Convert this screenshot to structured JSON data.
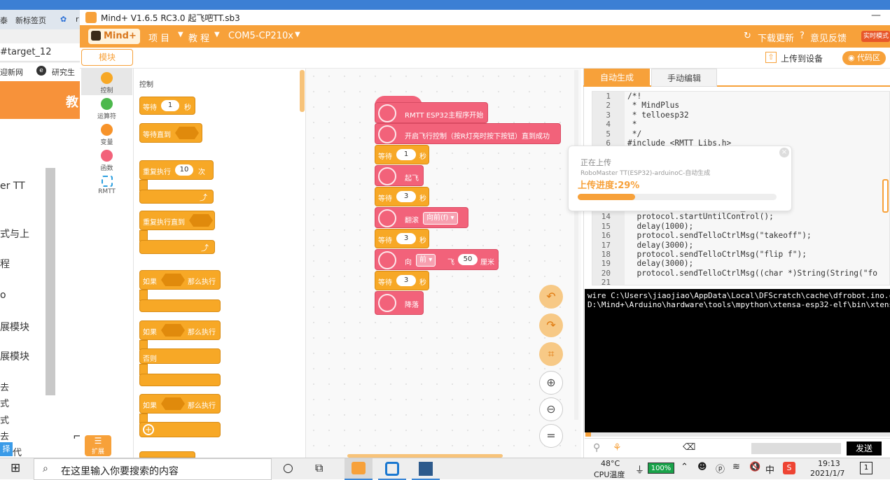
{
  "background": {
    "browser_tabs": [
      "泰",
      "新标签页",
      "r"
    ],
    "address": "#target_12",
    "bookmarks": [
      "迎新网",
      "研究生"
    ],
    "banner_char": "教",
    "side_items": [
      "er TT",
      "式与上",
      "程",
      "o",
      "展模块",
      "展模块",
      "去",
      "式",
      "式",
      "去",
      "代"
    ],
    "side_badge": "择"
  },
  "app": {
    "title": "Mind+ V1.6.5 RC3.0  起飞吧TT.sb3",
    "logo": "Mind+"
  },
  "menu": {
    "project": "项 目",
    "tutorial": "教 程",
    "port": "COM5-CP210x",
    "download_update": "下载更新",
    "feedback": "意见反馈",
    "realtime": "实时模式"
  },
  "toolbar": {
    "module_tab": "模块",
    "upload": "上传到设备",
    "code_area": "代码区"
  },
  "categories": [
    {
      "label": "控制",
      "color": "#f7a826"
    },
    {
      "label": "运算符",
      "color": "#4cb84c"
    },
    {
      "label": "变量",
      "color": "#f7932a"
    },
    {
      "label": "函数",
      "color": "#f2627a"
    },
    {
      "label": "RMTT",
      "color": "#2c9fe0"
    }
  ],
  "extension_label": "扩展",
  "palette": {
    "title": "控制",
    "wait": "等待",
    "wait_val": "1",
    "sec": "秒",
    "wait_until": "等待直到",
    "repeat": "重复执行",
    "repeat_val": "10",
    "times": "次",
    "repeat_until": "重复执行直到",
    "if1": "如果",
    "then1": "那么执行",
    "if2": "如果",
    "then2": "那么执行",
    "else": "否则",
    "if3": "如果",
    "then3": "那么执行"
  },
  "script": {
    "start": "RMTT ESP32主程序开始",
    "control": "开启飞行控制（按R灯亮时按下按钮）直到成功",
    "wait": "等待",
    "sec": "秒",
    "wait1": "1",
    "wait2": "3",
    "wait3": "3",
    "wait4": "3",
    "takeoff": "起飞",
    "flip": "翻滚",
    "flip_dir": "向前(f)",
    "move": "向",
    "move_dir": "前",
    "move_fly": "飞",
    "move_val": "50",
    "move_unit": "厘米",
    "land": "降落"
  },
  "code_tabs": {
    "auto": "自动生成",
    "manual": "手动编辑"
  },
  "code_lines": [
    {
      "n": "1",
      "t": "/*!"
    },
    {
      "n": "2",
      "t": " * MindPlus"
    },
    {
      "n": "3",
      "t": " * telloesp32"
    },
    {
      "n": "4",
      "t": " *"
    },
    {
      "n": "5",
      "t": " */"
    },
    {
      "n": "6",
      "t": "#include <RMTT_Libs.h>"
    }
  ],
  "code_lines2": [
    {
      "n": "",
      "t": "                  SERIAL_8N1);"
    },
    {
      "n": "14",
      "t": "  protocol.startUntilControl();"
    },
    {
      "n": "15",
      "t": "  delay(1000);"
    },
    {
      "n": "16",
      "t": "  protocol.sendTelloCtrlMsg(\"takeoff\");"
    },
    {
      "n": "17",
      "t": "  delay(3000);"
    },
    {
      "n": "18",
      "t": "  protocol.sendTelloCtrlMsg(\"flip f\");"
    },
    {
      "n": "19",
      "t": "  delay(3000);"
    },
    {
      "n": "20",
      "t": "  protocol.sendTelloCtrlMsg((char *)String(String(\"fo"
    },
    {
      "n": "21",
      "t": ""
    }
  ],
  "upload_popup": {
    "status": "正在上传",
    "detail": "RoboMaster TT(ESP32)-arduinoC-自动生成",
    "progress_text": "上传进度:29%",
    "progress": 0.29
  },
  "console": {
    "line1": "wire C:\\Users\\jiaojiao\\AppData\\Local\\DFScratch\\cache\\dfrobot.ino.c",
    "line2": "D:\\Mind+\\Arduino\\hardware\\tools\\mpython\\xtensa-esp32-elf\\bin\\xtens"
  },
  "send_label": "发送",
  "taskbar": {
    "search": "在这里输入你要搜索的内容",
    "temp": "48°C",
    "cpu": "CPU温度",
    "battery": "100%",
    "lang": "中",
    "time": "19:13",
    "date": "2021/1/7",
    "notif": "1"
  }
}
